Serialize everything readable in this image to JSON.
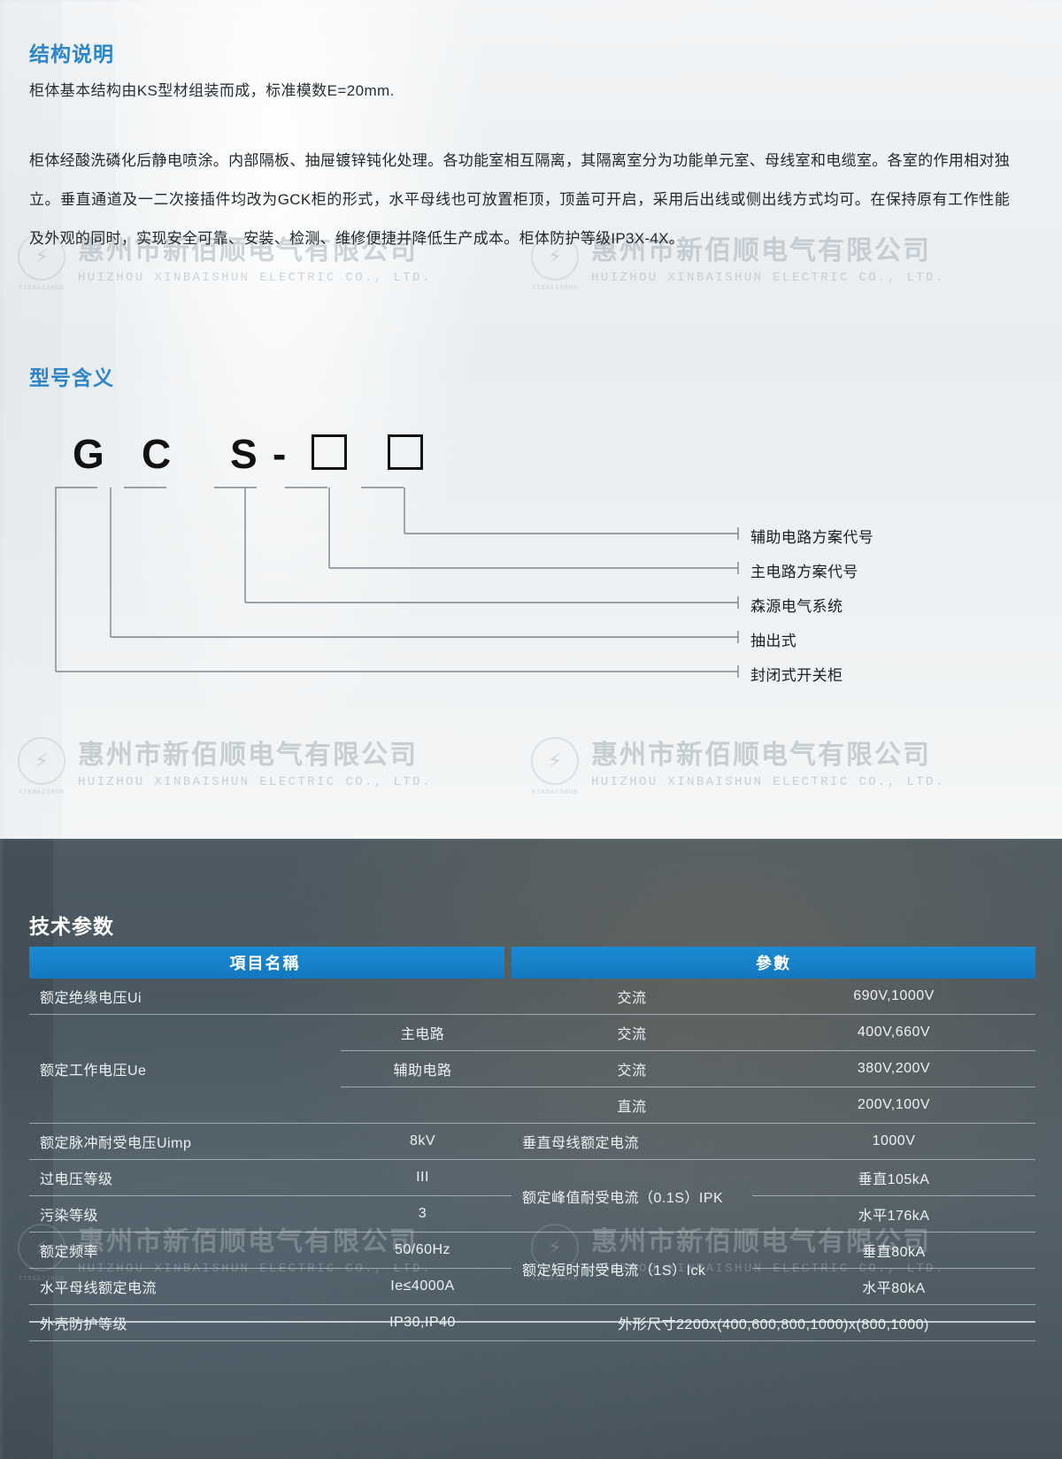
{
  "colors": {
    "heading_blue": "#2b85c8",
    "table_header_blue": "#1378bf",
    "dark_panel": "#4e5b63"
  },
  "sections": {
    "structure": {
      "heading": "结构说明",
      "intro": "柜体基本结构由KS型材组装而成，标准模数E=20mm.",
      "body": "柜体经酸洗磷化后静电喷涂。内部隔板、抽屉镀锌钝化处理。各功能室相互隔离，其隔离室分为功能单元室、母线室和电缆室。各室的作用相对独立。垂直通道及一二次接插件均改为GCK柜的形式，水平母线也可放置柜顶，顶盖可开启，采用后出线或侧出线方式均可。在保持原有工作性能及外观的同时，实现安全可靠、安装、检测、维修便捷并降低生产成本。柜体防护等级IP3X-4X。"
    },
    "model": {
      "heading": "型号含义",
      "code_parts": [
        "G",
        "C",
        "S",
        "-",
        "□",
        "□"
      ],
      "legend": [
        "辅助电路方案代号",
        "主电路方案代号",
        "森源电气系统",
        "抽出式",
        "封闭式开关柜"
      ]
    },
    "tech": {
      "heading": "技术参数",
      "columns": [
        "項目名稱",
        "參數"
      ],
      "rows": [
        {
          "item": "额定绝缘电压Ui",
          "sub": "",
          "type": "交流",
          "value": "690V,1000V"
        },
        {
          "item": "",
          "sub": "主电路",
          "type": "交流",
          "value": "400V,660V"
        },
        {
          "item": "额定工作电压Ue",
          "sub": "辅助电路",
          "type": "交流",
          "value": "380V,200V"
        },
        {
          "item": "",
          "sub": "",
          "type": "直流",
          "value": "200V,100V"
        },
        {
          "item": "额定脉冲耐受电压Uimp",
          "sub": "",
          "type": "8kV",
          "value": ""
        },
        {
          "item": "过电压等级",
          "sub": "",
          "type": "III",
          "value": ""
        },
        {
          "item": "污染等级",
          "sub": "",
          "type": "3",
          "value": ""
        },
        {
          "item": "额定频率",
          "sub": "",
          "type": "50/60Hz",
          "value": ""
        },
        {
          "item": "水平母线额定电流",
          "sub": "",
          "type": "Ie≤4000A",
          "value": ""
        },
        {
          "item": "外壳防护等级",
          "sub": "",
          "type": "IP30,IP40",
          "value": ""
        }
      ],
      "right_rows": [
        {
          "item": "垂直母线额定电流",
          "value": "1000V"
        },
        {
          "item": "额定峰值耐受电流（0.1S）IPK",
          "value": "垂直105kA"
        },
        {
          "item": "",
          "value": "水平176kA"
        },
        {
          "item": "额定短时耐受电流（1S）Ick",
          "value": "垂直80kA"
        },
        {
          "item": "",
          "value": "水平80kA"
        },
        {
          "item": "",
          "value": "外形尺寸2200x(400,600,800,1000)x(800,1000)"
        }
      ]
    }
  },
  "watermark": {
    "cn": "惠州市新佰顺电气有限公司",
    "en": "HUIZHOU XINBAISHUN ELECTRIC CO., LTD.",
    "badge": "XINBAISHUN",
    "bolt_icon": "⚡"
  }
}
